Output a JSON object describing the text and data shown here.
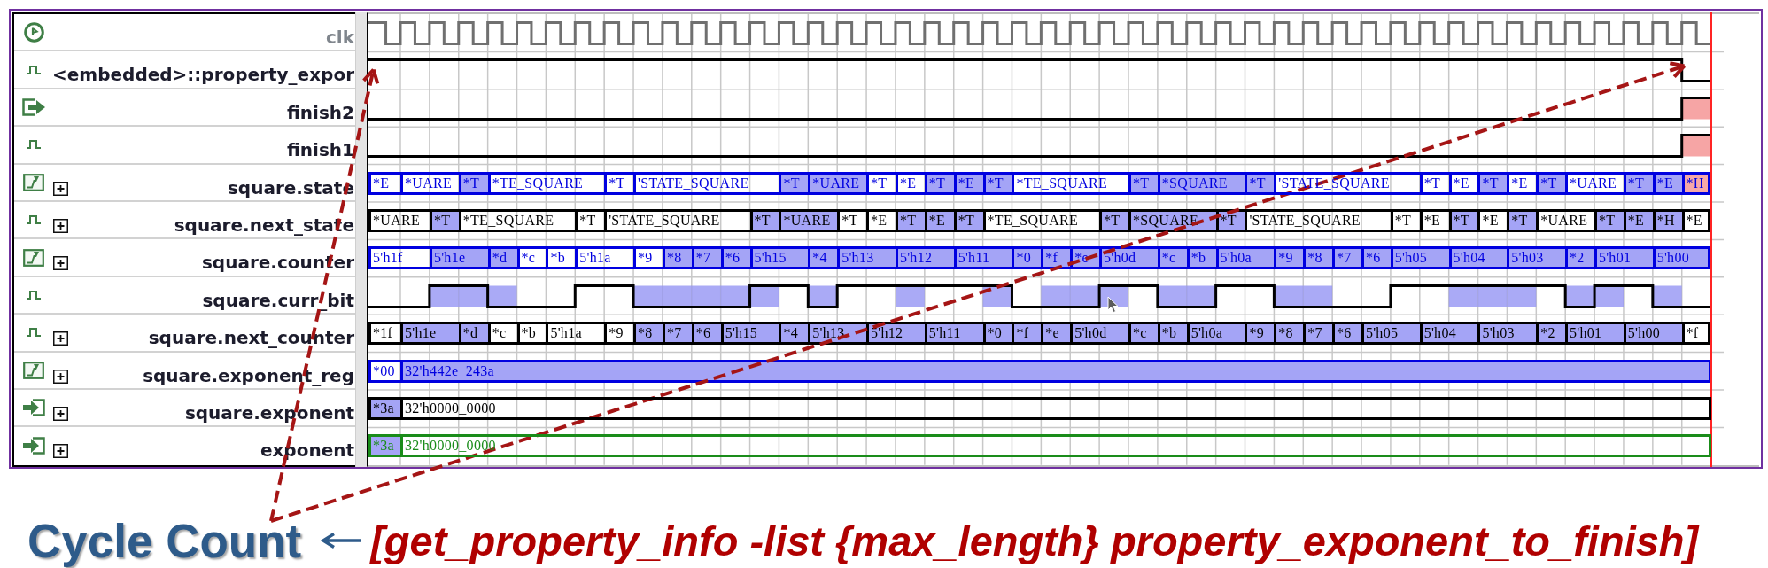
{
  "waveform_viewer": {
    "signals": [
      {
        "name": "clk",
        "kind": "clock",
        "expandable": false,
        "color": "#707070"
      },
      {
        "name": "<embedded>::property_expor",
        "kind": "pulse",
        "expandable": false,
        "color": "#000000"
      },
      {
        "name": "finish2",
        "kind": "output",
        "expandable": false,
        "color": "#000000"
      },
      {
        "name": "finish1",
        "kind": "pulse",
        "expandable": false,
        "color": "#000000"
      },
      {
        "name": "square.state",
        "kind": "register",
        "expandable": true,
        "color": "#0000e0",
        "segments": [
          {
            "label": "*E"
          },
          {
            "label": "*UARE"
          },
          {
            "label": "*T",
            "color": "#a4a4f6"
          },
          {
            "label": "*TE_SQUARE"
          },
          {
            "label": "*T"
          },
          {
            "label": "'STATE_SQUARE"
          },
          {
            "label": "*T",
            "color": "#a4a4f6"
          },
          {
            "label": "*UARE",
            "color": "#a4a4f6"
          },
          {
            "label": "*T"
          },
          {
            "label": "*E"
          },
          {
            "label": "*T",
            "color": "#a4a4f6"
          },
          {
            "label": "*E",
            "color": "#a4a4f6"
          },
          {
            "label": "*T",
            "color": "#a4a4f6"
          },
          {
            "label": "*TE_SQUARE"
          },
          {
            "label": "*T",
            "color": "#a4a4f6"
          },
          {
            "label": "*SQUARE",
            "color": "#a4a4f6"
          },
          {
            "label": "*T",
            "color": "#a4a4f6"
          },
          {
            "label": "'STATE_SQUARE"
          },
          {
            "label": "*T"
          },
          {
            "label": "*E"
          },
          {
            "label": "*T",
            "color": "#a4a4f6"
          },
          {
            "label": "*E"
          },
          {
            "label": "*T",
            "color": "#a4a4f6"
          },
          {
            "label": "*UARE"
          },
          {
            "label": "*T",
            "color": "#a4a4f6"
          },
          {
            "label": "*E",
            "color": "#a4a4f6"
          },
          {
            "label": "*H",
            "color": "#f6a8a8"
          }
        ]
      },
      {
        "name": "square.next_state",
        "kind": "pulse",
        "expandable": true,
        "color": "#000000",
        "segments": [
          {
            "label": "*UARE"
          },
          {
            "label": "*T",
            "color": "#a4a4f6"
          },
          {
            "label": "*TE_SQUARE"
          },
          {
            "label": "*T"
          },
          {
            "label": "'STATE_SQUARE"
          },
          {
            "label": "*T",
            "color": "#a4a4f6"
          },
          {
            "label": "*UARE",
            "color": "#a4a4f6"
          },
          {
            "label": "*T"
          },
          {
            "label": "*E"
          },
          {
            "label": "*T",
            "color": "#a4a4f6"
          },
          {
            "label": "*E",
            "color": "#a4a4f6"
          },
          {
            "label": "*T",
            "color": "#a4a4f6"
          },
          {
            "label": "*TE_SQUARE"
          },
          {
            "label": "*T",
            "color": "#a4a4f6"
          },
          {
            "label": "*SQUARE",
            "color": "#a4a4f6"
          },
          {
            "label": "*T",
            "color": "#a4a4f6"
          },
          {
            "label": "'STATE_SQUARE"
          },
          {
            "label": "*T"
          },
          {
            "label": "*E"
          },
          {
            "label": "*T",
            "color": "#a4a4f6"
          },
          {
            "label": "*E"
          },
          {
            "label": "*T",
            "color": "#a4a4f6"
          },
          {
            "label": "*UARE"
          },
          {
            "label": "*T",
            "color": "#a4a4f6"
          },
          {
            "label": "*E",
            "color": "#a4a4f6"
          },
          {
            "label": "*H",
            "color": "#a4a4f6"
          },
          {
            "label": "*E"
          }
        ]
      },
      {
        "name": "square.counter",
        "kind": "register",
        "expandable": true,
        "color": "#0000e0",
        "segments": [
          {
            "label": "5'h1f"
          },
          {
            "label": "5'h1e",
            "color": "#a4a4f6"
          },
          {
            "label": "*d",
            "color": "#a4a4f6"
          },
          {
            "label": "*c"
          },
          {
            "label": "*b"
          },
          {
            "label": "5'h1a"
          },
          {
            "label": "*9"
          },
          {
            "label": "*8",
            "color": "#a4a4f6"
          },
          {
            "label": "*7",
            "color": "#a4a4f6"
          },
          {
            "label": "*6",
            "color": "#a4a4f6"
          },
          {
            "label": "5'h15",
            "color": "#a4a4f6"
          },
          {
            "label": "*4",
            "color": "#a4a4f6"
          },
          {
            "label": "5'h13",
            "color": "#a4a4f6"
          },
          {
            "label": "5'h12",
            "color": "#a4a4f6"
          },
          {
            "label": "5'h11",
            "color": "#a4a4f6"
          },
          {
            "label": "*0",
            "color": "#a4a4f6"
          },
          {
            "label": "*f",
            "color": "#a4a4f6"
          },
          {
            "label": "*e",
            "color": "#a4a4f6"
          },
          {
            "label": "5'h0d",
            "color": "#a4a4f6"
          },
          {
            "label": "*c",
            "color": "#a4a4f6"
          },
          {
            "label": "*b",
            "color": "#a4a4f6"
          },
          {
            "label": "5'h0a",
            "color": "#a4a4f6"
          },
          {
            "label": "*9",
            "color": "#a4a4f6"
          },
          {
            "label": "*8",
            "color": "#a4a4f6"
          },
          {
            "label": "*7",
            "color": "#a4a4f6"
          },
          {
            "label": "*6",
            "color": "#a4a4f6"
          },
          {
            "label": "5'h05",
            "color": "#a4a4f6"
          },
          {
            "label": "5'h04",
            "color": "#a4a4f6"
          },
          {
            "label": "5'h03",
            "color": "#a4a4f6"
          },
          {
            "label": "*2",
            "color": "#a4a4f6"
          },
          {
            "label": "5'h01",
            "color": "#a4a4f6"
          },
          {
            "label": "5'h00",
            "color": "#a4a4f6"
          }
        ]
      },
      {
        "name": "square.curr_bit",
        "kind": "pulse",
        "expandable": false,
        "color": "#000000"
      },
      {
        "name": "square.next_counter",
        "kind": "pulse",
        "expandable": true,
        "color": "#000000",
        "segments": [
          {
            "label": "*1f"
          },
          {
            "label": "5'h1e",
            "color": "#a4a4f6"
          },
          {
            "label": "*d",
            "color": "#a4a4f6"
          },
          {
            "label": "*c"
          },
          {
            "label": "*b"
          },
          {
            "label": "5'h1a"
          },
          {
            "label": "*9"
          },
          {
            "label": "*8",
            "color": "#a4a4f6"
          },
          {
            "label": "*7",
            "color": "#a4a4f6"
          },
          {
            "label": "*6",
            "color": "#a4a4f6"
          },
          {
            "label": "5'h15",
            "color": "#a4a4f6"
          },
          {
            "label": "*4",
            "color": "#a4a4f6"
          },
          {
            "label": "5'h13",
            "color": "#a4a4f6"
          },
          {
            "label": "5'h12",
            "color": "#a4a4f6"
          },
          {
            "label": "5'h11",
            "color": "#a4a4f6"
          },
          {
            "label": "*0",
            "color": "#a4a4f6"
          },
          {
            "label": "*f",
            "color": "#a4a4f6"
          },
          {
            "label": "*e",
            "color": "#a4a4f6"
          },
          {
            "label": "5'h0d",
            "color": "#a4a4f6"
          },
          {
            "label": "*c",
            "color": "#a4a4f6"
          },
          {
            "label": "*b",
            "color": "#a4a4f6"
          },
          {
            "label": "5'h0a",
            "color": "#a4a4f6"
          },
          {
            "label": "*9",
            "color": "#a4a4f6"
          },
          {
            "label": "*8",
            "color": "#a4a4f6"
          },
          {
            "label": "*7",
            "color": "#a4a4f6"
          },
          {
            "label": "*6",
            "color": "#a4a4f6"
          },
          {
            "label": "5'h05",
            "color": "#a4a4f6"
          },
          {
            "label": "5'h04",
            "color": "#a4a4f6"
          },
          {
            "label": "5'h03",
            "color": "#a4a4f6"
          },
          {
            "label": "*2",
            "color": "#a4a4f6"
          },
          {
            "label": "5'h01",
            "color": "#a4a4f6"
          },
          {
            "label": "5'h00",
            "color": "#a4a4f6"
          },
          {
            "label": "*f"
          }
        ]
      },
      {
        "name": "square.exponent_reg",
        "kind": "register",
        "expandable": true,
        "color": "#0000e0",
        "segments": [
          {
            "label": "*00"
          },
          {
            "label": "32'h442e_243a",
            "color": "#a4a4f6"
          }
        ]
      },
      {
        "name": "square.exponent",
        "kind": "input",
        "expandable": true,
        "color": "#000000",
        "segments": [
          {
            "label": "*3a",
            "color": "#a4a4f6"
          },
          {
            "label": "32'h0000_0000"
          }
        ]
      },
      {
        "name": "exponent",
        "kind": "input",
        "expandable": true,
        "color": "#1a8c1a",
        "segments": [
          {
            "label": "*3a",
            "color": "#a4a4f6"
          },
          {
            "label": "32'h0000_0000"
          }
        ]
      }
    ]
  },
  "caption": {
    "label": "Cycle Count",
    "command": "[get_property_info -list {max_length} property_exponent_to_finish]"
  }
}
